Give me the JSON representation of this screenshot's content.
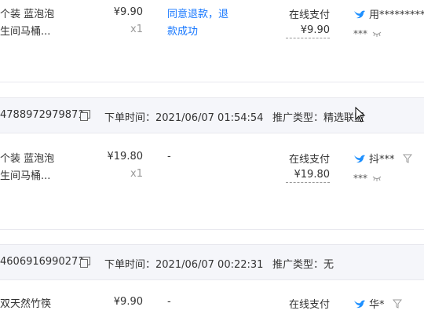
{
  "orders": [
    {
      "product": {
        "line1": "个装 蓝泡泡",
        "line2": "生间马桶..."
      },
      "price": "¥9.90",
      "qty": "x1",
      "status_line1": "同意退款，退",
      "status_line2": "款成功",
      "pay_method": "在线支付",
      "pay_amount": "¥9.90",
      "buyer": "用*********",
      "stars": "***"
    },
    {
      "header": {
        "order_no": "4788972979871",
        "time_label": "下单时间：2021/06/07 01:54:54",
        "promo_label": "推广类型：精选联盟"
      },
      "product": {
        "line1": "个装 蓝泡泡",
        "line2": "生间马桶..."
      },
      "price": "¥19.80",
      "qty": "x1",
      "status": "-",
      "pay_method": "在线支付",
      "pay_amount": "¥19.80",
      "buyer": "抖***",
      "stars": "***"
    },
    {
      "header": {
        "order_no": "4606916990271",
        "time_label": "下单时间：2021/06/07 00:22:31",
        "promo_label": "推广类型：无"
      },
      "product": {
        "line1": "双天然竹筷"
      },
      "price": "¥9.90",
      "status": "-",
      "pay_method": "在线支付",
      "buyer": "华*"
    }
  ],
  "colors": {
    "link": "#1677ff",
    "band": "#f5f6fa",
    "muted": "#999999"
  },
  "icons": [
    "copy-icon",
    "bird-icon",
    "filter-icon",
    "eye-closed-icon",
    "cursor-icon"
  ]
}
